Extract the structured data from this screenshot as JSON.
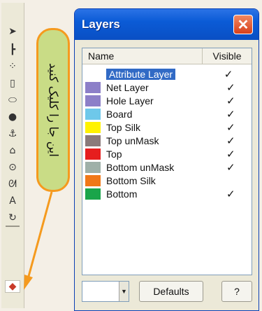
{
  "tools": [
    {
      "icon": "pointer-arrow-icon",
      "glyph": "➤"
    },
    {
      "icon": "wire-tool-icon",
      "glyph": "┣"
    },
    {
      "icon": "dots-tool-icon",
      "glyph": "⁘"
    },
    {
      "icon": "rectangle-tool-icon",
      "glyph": "▯"
    },
    {
      "icon": "ellipse-tool-icon",
      "glyph": "⬭"
    },
    {
      "icon": "fill-tool-icon",
      "glyph": "●"
    },
    {
      "icon": "via-tool-icon",
      "glyph": "⚓"
    },
    {
      "icon": "polygon-tool-icon",
      "glyph": "⌂"
    },
    {
      "icon": "circle-target-icon",
      "glyph": "⊙"
    },
    {
      "icon": "arc-tool-icon",
      "glyph": "ᘛ"
    },
    {
      "icon": "text-tool-icon",
      "glyph": "A"
    },
    {
      "icon": "rotate-tool-icon",
      "glyph": "↻"
    },
    {
      "icon": "separator",
      "glyph": ""
    },
    {
      "icon": "layers-stack-icon",
      "glyph": "◆"
    }
  ],
  "callout": {
    "text": "این جا را کلیک کنید",
    "border_color": "#f59a1e",
    "fill_color": "#c9dc86"
  },
  "window": {
    "title": "Layers",
    "close_label": "✕"
  },
  "list": {
    "headers": {
      "name": "Name",
      "visible": "Visible"
    },
    "layers": [
      {
        "name": "Attribute Layer",
        "color": "",
        "visible": "✓",
        "selected": true
      },
      {
        "name": "Net Layer",
        "color": "#8c7fc8",
        "visible": "✓",
        "selected": false
      },
      {
        "name": "Hole Layer",
        "color": "#8c7fc8",
        "visible": "✓",
        "selected": false
      },
      {
        "name": "Board",
        "color": "#6ec8ea",
        "visible": "✓",
        "selected": false
      },
      {
        "name": "Top Silk",
        "color": "#fff200",
        "visible": "✓",
        "selected": false
      },
      {
        "name": "Top unMask",
        "color": "#8a7a7a",
        "visible": "✓",
        "selected": false
      },
      {
        "name": "Top",
        "color": "#e61e1e",
        "visible": "✓",
        "selected": false
      },
      {
        "name": "Bottom unMask",
        "color": "#9fb0a8",
        "visible": "✓",
        "selected": false
      },
      {
        "name": "Bottom Silk",
        "color": "#f07818",
        "visible": "",
        "selected": false
      },
      {
        "name": "Bottom",
        "color": "#1aa54a",
        "visible": "✓",
        "selected": false
      }
    ]
  },
  "bottom": {
    "defaults_label": "Defaults",
    "help_label": "?",
    "combo_arrow": "▼"
  }
}
